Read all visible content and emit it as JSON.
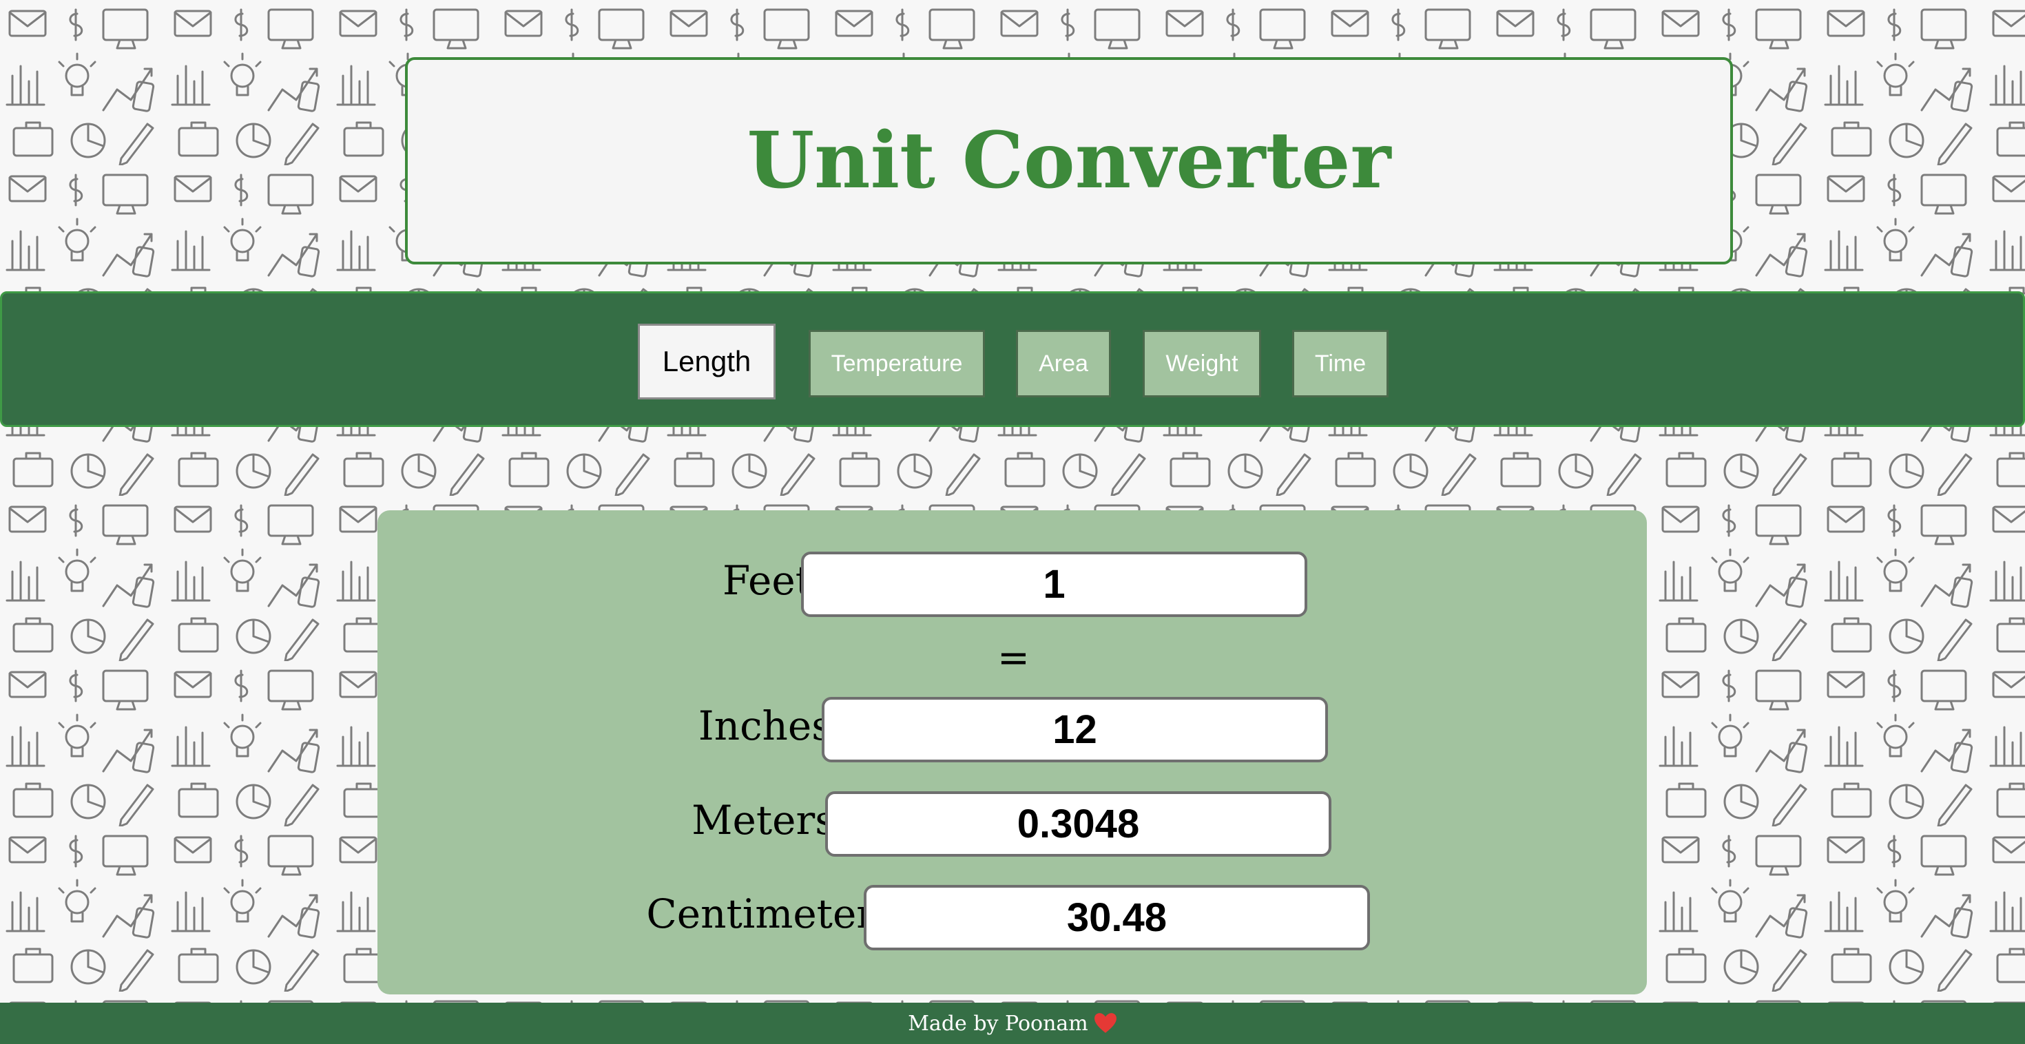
{
  "header": {
    "title": "Unit Converter"
  },
  "nav": {
    "tabs": [
      {
        "label": "Length",
        "active": true
      },
      {
        "label": "Temperature",
        "active": false
      },
      {
        "label": "Area",
        "active": false
      },
      {
        "label": "Weight",
        "active": false
      },
      {
        "label": "Time",
        "active": false
      }
    ]
  },
  "converter": {
    "from_label": "Feet",
    "from_value": "1",
    "equals": "=",
    "outputs": [
      {
        "label": "Inches",
        "value": "12"
      },
      {
        "label": "Meters",
        "value": "0.3048"
      },
      {
        "label": "Centimeter",
        "value": "30.48"
      }
    ]
  },
  "footer": {
    "text": "Made by Poonam",
    "heart_icon": "heart-icon"
  },
  "colors": {
    "brand_green": "#3d8a3b",
    "nav_green": "#356e45",
    "panel_green": "#a2c39f",
    "heart_red": "#e53935"
  }
}
